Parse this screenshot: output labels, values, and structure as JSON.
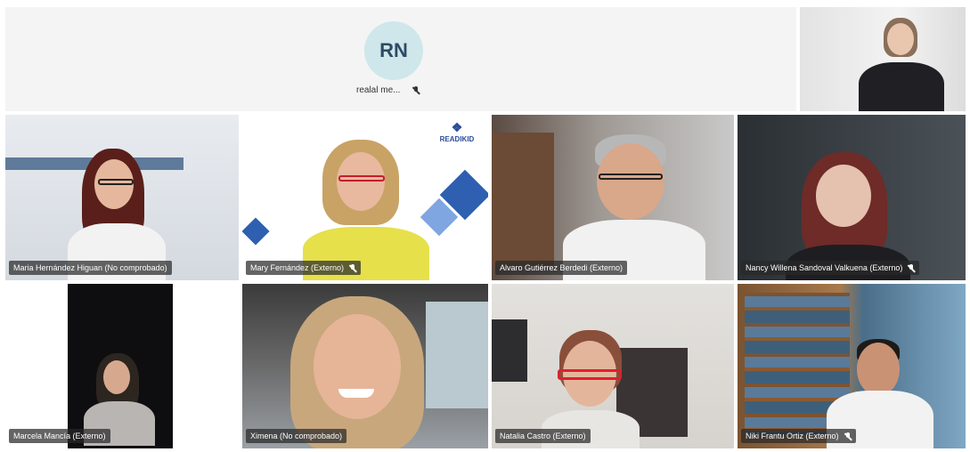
{
  "top": {
    "avatar_initials": "RN",
    "avatar_name": "realal me..."
  },
  "tiles": [
    {
      "name": "Maria Hernández Higuan (No comprobado)"
    },
    {
      "name": "Mary Fernández (Externo)"
    },
    {
      "name": "Alvaro Gutiérrez Berdedi (Externo)"
    },
    {
      "name": "Nancy Willena Sandoval Valkuena (Externo)"
    },
    {
      "name": "Marcela Mancía (Externo)"
    },
    {
      "name": "Ximena (No comprobado)"
    },
    {
      "name": "Natalia Castro (Externo)"
    },
    {
      "name": "Niki Frantu Ortiz (Externo)"
    }
  ],
  "logo_text": "READIKID",
  "icons": {
    "mic": "mic-off-icon"
  }
}
